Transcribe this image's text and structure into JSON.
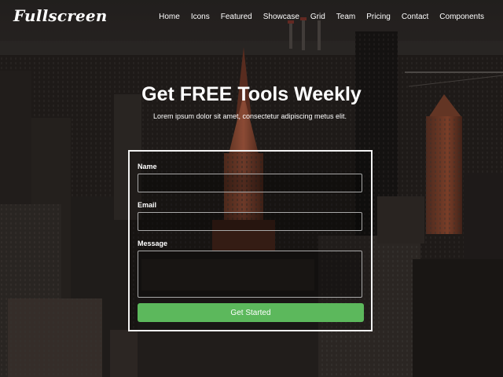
{
  "brand": "Fullscreen",
  "nav": [
    "Home",
    "Icons",
    "Featured",
    "Showcase",
    "Grid",
    "Team",
    "Pricing",
    "Contact",
    "Components"
  ],
  "hero": {
    "title": "Get FREE Tools Weekly",
    "subtitle": "Lorem ipsum dolor sit amet, consectetur adipiscing metus elit."
  },
  "form": {
    "name_label": "Name",
    "name_value": "",
    "email_label": "Email",
    "email_value": "",
    "message_label": "Message",
    "message_value": "",
    "submit_label": "Get Started"
  },
  "colors": {
    "submit_button": "#5cb85c",
    "text": "#ffffff",
    "form_border": "#f2f2f2"
  }
}
